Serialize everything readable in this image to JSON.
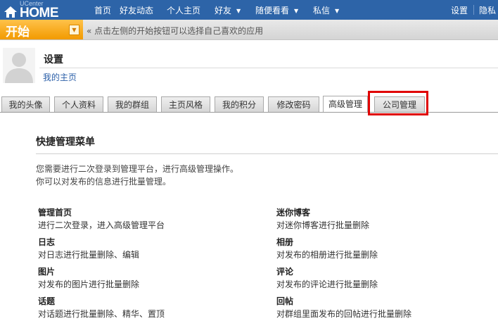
{
  "topnav": {
    "logo_small": "UCenter",
    "logo_big": "HOME",
    "items": [
      "首页",
      "好友动态",
      "个人主页",
      "好友",
      "随便看看",
      "私信"
    ],
    "right": [
      "设置",
      "隐私"
    ]
  },
  "startbar": {
    "start_label": "开始",
    "hint": "« 点击左侧的开始按钮可以选择自己喜欢的应用"
  },
  "profile": {
    "title": "设置",
    "home_link": "我的主页"
  },
  "tabs": [
    "我的头像",
    "个人资料",
    "我的群组",
    "主页风格",
    "我的积分",
    "修改密码",
    "高级管理",
    "公司管理"
  ],
  "active_tab": "高级管理",
  "highlighted_tab": "公司管理",
  "content": {
    "section_title": "快捷管理菜单",
    "intro_line1": "您需要进行二次登录到管理平台，进行高级管理操作。",
    "intro_line2": "你可以对发布的信息进行批量管理。",
    "left_items": [
      {
        "title": "管理首页",
        "desc": "进行二次登录，进入高级管理平台"
      },
      {
        "title": "日志",
        "desc": "对日志进行批量删除、编辑"
      },
      {
        "title": "图片",
        "desc": "对发布的图片进行批量删除"
      },
      {
        "title": "话题",
        "desc": "对话题进行批量删除、精华、置顶"
      }
    ],
    "right_items": [
      {
        "title": "迷你博客",
        "desc": "对迷你博客进行批量删除"
      },
      {
        "title": "相册",
        "desc": "对发布的相册进行批量删除"
      },
      {
        "title": "评论",
        "desc": "对发布的评论进行批量删除"
      },
      {
        "title": "回帖",
        "desc": "对群组里面发布的回帖进行批量删除"
      }
    ]
  },
  "colors": {
    "topbar": "#2d64a8",
    "start_button": "#f29a00",
    "highlight_border": "#e00000",
    "link": "#2b5fa8"
  }
}
